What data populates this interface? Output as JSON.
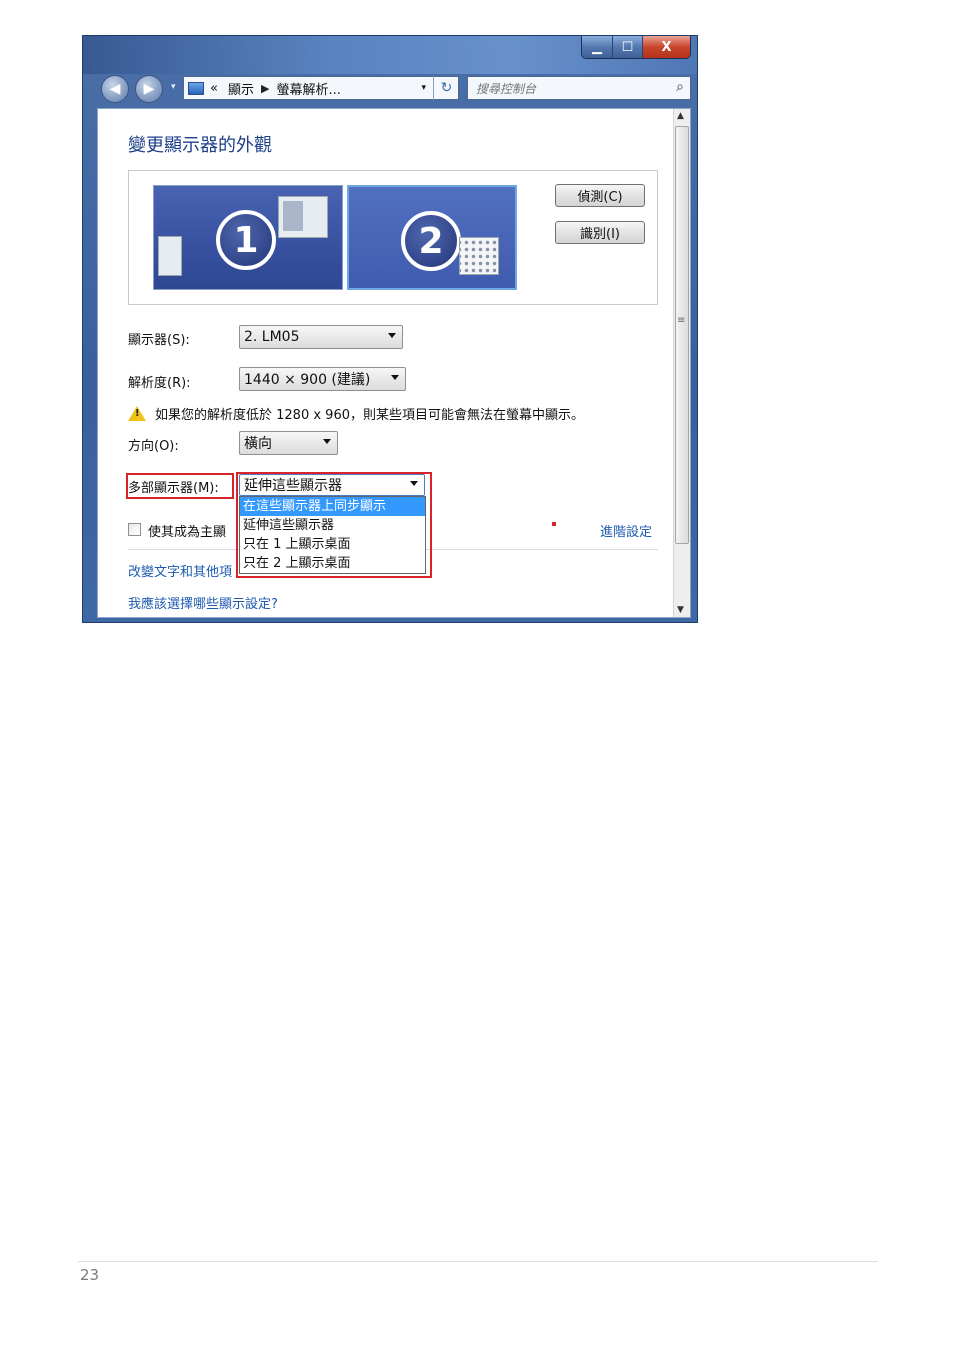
{
  "window": {
    "controls": {
      "minimize": "▁",
      "maximize": "☐",
      "close": "X"
    },
    "nav": {
      "back": "◀",
      "forward": "▶",
      "address_prefix": "«",
      "breadcrumb": [
        "顯示",
        "螢幕解析..."
      ],
      "breadcrumb_sep": "▶",
      "address_dropdown": "▾",
      "refresh": "↻",
      "search_placeholder": "搜尋控制台",
      "search_icon": "⌕"
    }
  },
  "content": {
    "title": "變更顯示器的外觀",
    "monitors": [
      {
        "number": "1"
      },
      {
        "number": "2"
      }
    ],
    "buttons": {
      "detect": "偵測(C)",
      "identify": "識別(I)"
    },
    "display_label": "顯示器(S):",
    "display_value": "2. LM05",
    "resolution_label": "解析度(R):",
    "resolution_value": "1440 × 900 (建議)",
    "warning_text": "如果您的解析度低於 1280 x 960，則某些項目可能會無法在螢幕中顯示。",
    "orientation_label": "方向(O):",
    "orientation_value": "橫向",
    "multi_label": "多部顯示器(M):",
    "multi_value": "延伸這些顯示器",
    "multi_options": [
      "在這些顯示器上同步顯示",
      "延伸這些顯示器",
      "只在 1 上顯示桌面",
      "只在 2 上顯示桌面"
    ],
    "checkbox_label": "使其成為主顯",
    "advanced_link": "進階設定",
    "link_text_size": "改變文字和其他項",
    "link_which": "我應該選擇哪些顯示設定?"
  },
  "colors": {
    "accent": "#1e5bb0",
    "highlight": "#3399ff",
    "annotation": "#d8232a"
  },
  "page": {
    "number": "23"
  }
}
